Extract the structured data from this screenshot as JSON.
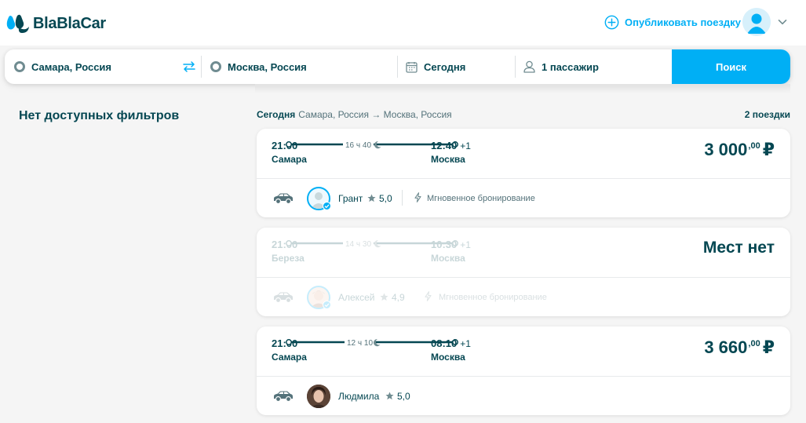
{
  "brand": {
    "name": "BlaBlaCar",
    "accent": "#00aff5",
    "text": "#054752"
  },
  "header": {
    "publish_label": "Опубликовать поездку",
    "publish_icon": "plus-circle-icon",
    "avatar_icon": "user-avatar-icon",
    "menu_icon": "chevron-down-icon"
  },
  "search": {
    "from": "Самара, Россия",
    "to": "Москва, Россия",
    "date": "Сегодня",
    "passengers": "1 пассажир",
    "button_label": "Поиск",
    "swap_icon": "swap-arrows-icon"
  },
  "filters": {
    "empty_label": "Нет доступных фильтров"
  },
  "results": {
    "date": "Сегодня",
    "route": "Самара, Россия → Москва, Россия",
    "count": "2 поездки"
  },
  "rides": [
    {
      "depart_time": "21:00",
      "duration": "16 ч 40",
      "arrive_time": "12:40",
      "day_offset": "+1",
      "from_city": "Самара",
      "to_city": "Москва",
      "price_main": "3 000",
      "price_cents": ",00",
      "currency": "₽",
      "driver": "Грант",
      "rating": "5,0",
      "instant": "Мгновенное бронирование",
      "full": false
    },
    {
      "depart_time": "21:00",
      "duration": "14 ч 30",
      "arrive_time": "10:30",
      "day_offset": "+1",
      "from_city": "Береза",
      "to_city": "Москва",
      "no_seats": "Мест нет",
      "driver": "Алексей",
      "rating": "4,9",
      "instant": "Мгновенное бронирование",
      "full": true
    },
    {
      "depart_time": "21:00",
      "duration": "12 ч 10",
      "arrive_time": "08:10",
      "day_offset": "+1",
      "from_city": "Самара",
      "to_city": "Москва",
      "price_main": "3 660",
      "price_cents": ",00",
      "currency": "₽",
      "driver": "Людмила",
      "rating": "5,0",
      "full": false
    }
  ]
}
